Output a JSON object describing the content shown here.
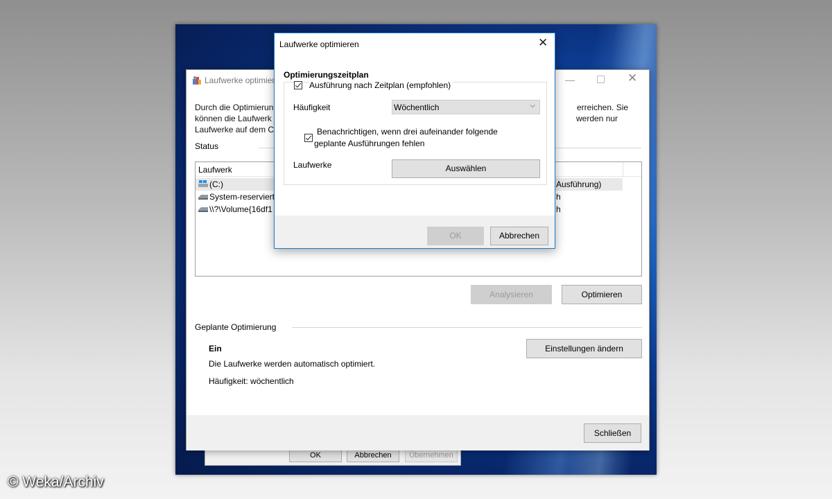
{
  "back_window": {
    "title": "Laufwerke optimieren",
    "description_lines": [
      "Durch die Optimierung",
      "können die Laufwerk",
      "Laufwerke auf dem C"
    ],
    "description_right_lines": [
      "erreichen. Sie",
      "werden nur"
    ],
    "status_label": "Status",
    "list": {
      "column_laufwerk": "Laufwerk",
      "rows": [
        {
          "name": "(C:)",
          "status": "Ausführung)"
        },
        {
          "name": "System-reserviert",
          "status": "h"
        },
        {
          "name": "\\\\?\\Volume{16df1",
          "status": "h"
        }
      ]
    },
    "analyze_button": "Analysieren",
    "optimize_button": "Optimieren",
    "scheduled_label": "Geplante Optimierung",
    "scheduled_state": "Ein",
    "scheduled_desc": "Die Laufwerke werden automatisch optimiert.",
    "scheduled_freq": "Häufigkeit: wöchentlich",
    "change_settings_button": "Einstellungen ändern",
    "close_button": "Schließen"
  },
  "properties_window": {
    "ok_button": "OK",
    "cancel_button": "Abbrechen",
    "apply_button": "Übernehmen"
  },
  "dialog": {
    "title": "Laufwerke optimieren",
    "heading": "Optimierungszeitplan",
    "run_on_schedule": "Ausführung nach Zeitplan (empfohlen)",
    "frequency_label": "Häufigkeit",
    "frequency_value": "Wöchentlich",
    "notify_line1": "Benachrichtigen, wenn drei aufeinander folgende",
    "notify_line2": "geplante Ausführungen fehlen",
    "drives_label": "Laufwerke",
    "select_button": "Auswählen",
    "ok_button": "OK",
    "cancel_button": "Abbrechen"
  },
  "watermark": "© Weka/Archiv",
  "colors": {
    "accent": "#0078d7",
    "disabled_button": "#cfcfcf"
  }
}
